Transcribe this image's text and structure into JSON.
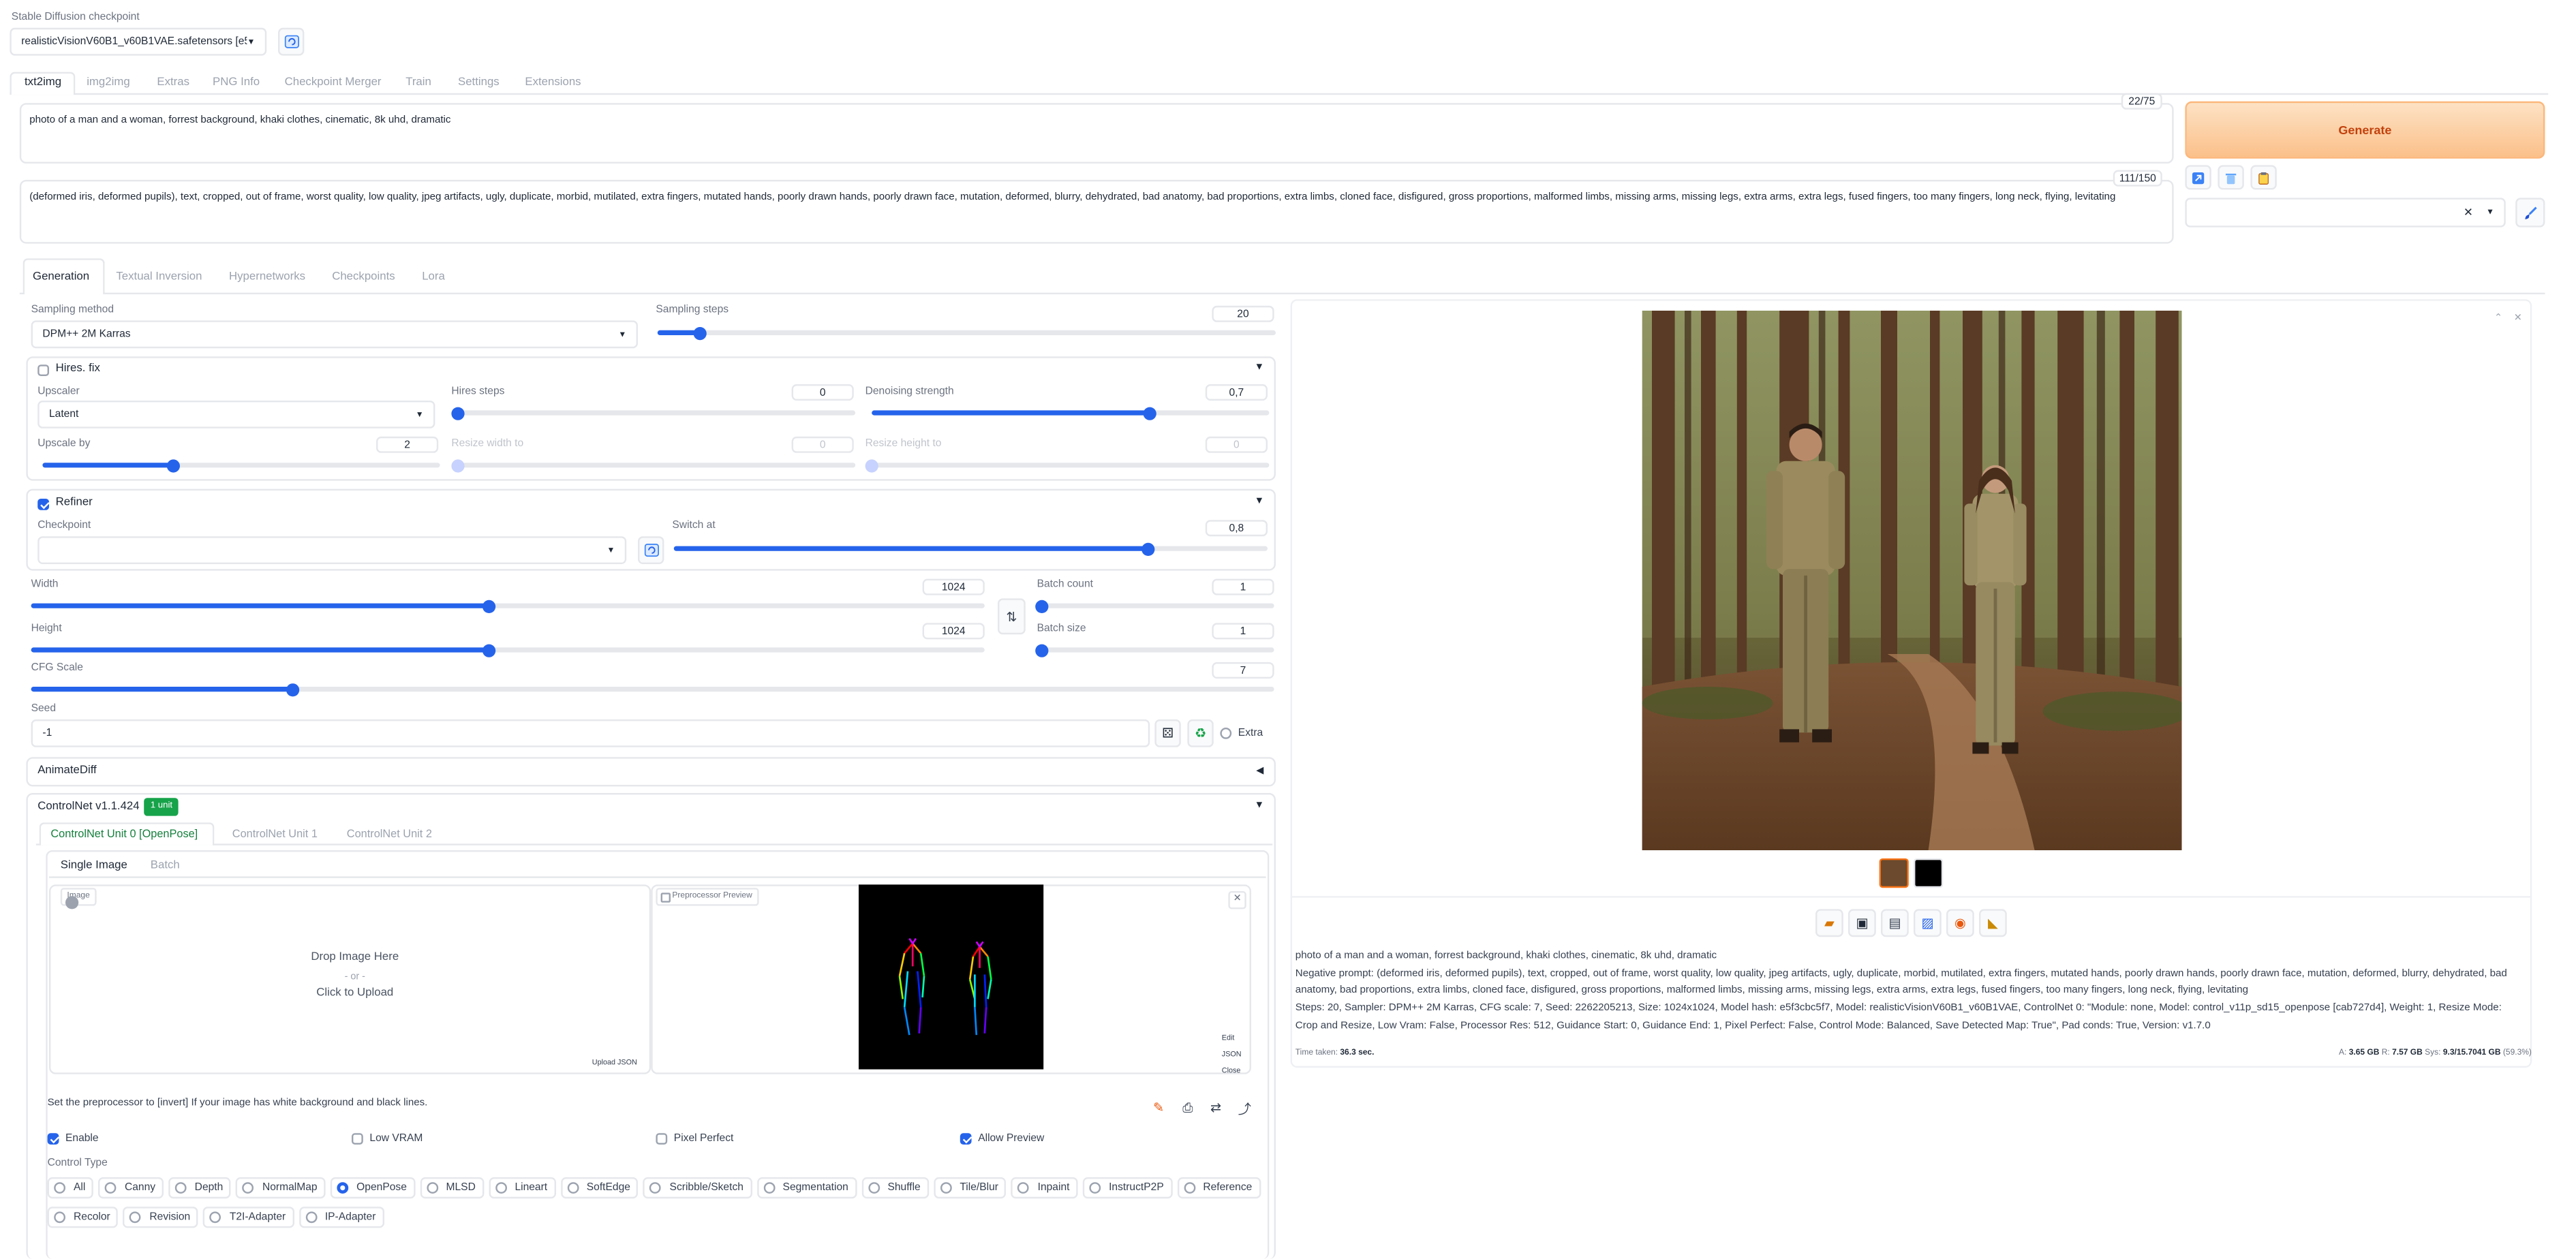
{
  "checkpoint": {
    "label": "Stable Diffusion checkpoint",
    "value": "realisticVisionV60B1_v60B1VAE.safetensors [e5f"
  },
  "main_tabs": [
    "txt2img",
    "img2img",
    "Extras",
    "PNG Info",
    "Checkpoint Merger",
    "Train",
    "Settings",
    "Extensions"
  ],
  "prompt": {
    "text": "photo of a man and a woman, forrest background, khaki clothes, cinematic, 8k uhd, dramatic",
    "counter": "22/75"
  },
  "negative": {
    "text": "(deformed iris, deformed pupils), text, cropped, out of frame, worst quality, low quality, jpeg artifacts, ugly, duplicate, morbid, mutilated, extra fingers, mutated hands, poorly drawn hands, poorly drawn face, mutation, deformed, blurry, dehydrated, bad anatomy, bad proportions, extra limbs, cloned face, disfigured, gross proportions, malformed limbs, missing arms, missing legs, extra arms, extra legs, fused fingers, too many fingers, long neck, flying, levitating",
    "counter": "111/150"
  },
  "generate_label": "Generate",
  "colors": {
    "accent": "#2563eb",
    "generate_start": "#fdd5ad",
    "generate_end": "#fbbf85",
    "generate_text": "#c2410c",
    "badge": "#16a34a",
    "cn_active": "#15803d"
  },
  "sub_tabs": [
    "Generation",
    "Textual Inversion",
    "Hypernetworks",
    "Checkpoints",
    "Lora"
  ],
  "sampling": {
    "method_label": "Sampling method",
    "method": "DPM++ 2M Karras",
    "steps_label": "Sampling steps",
    "steps": "20",
    "steps_frac": 0.07
  },
  "hires": {
    "label": "Hires. fix",
    "checked": false,
    "upscaler_label": "Upscaler",
    "upscaler": "Latent",
    "steps_label": "Hires steps",
    "steps": "0",
    "denoise_label": "Denoising strength",
    "denoise": "0,7",
    "upscale_label": "Upscale by",
    "upscale": "2",
    "rw_label": "Resize width to",
    "rw": "0",
    "rh_label": "Resize height to",
    "rh": "0",
    "denoise_frac": 0.7,
    "upscale_frac": 0.33
  },
  "refiner": {
    "label": "Refiner",
    "checked": true,
    "checkpoint_label": "Checkpoint",
    "switch_label": "Switch at",
    "switch": "0,8",
    "switch_frac": 0.8
  },
  "dims": {
    "width_label": "Width",
    "width": "1024",
    "height_label": "Height",
    "height": "1024",
    "bc_label": "Batch count",
    "bc": "1",
    "bs_label": "Batch size",
    "bs": "1",
    "cfg_label": "CFG Scale",
    "cfg": "7",
    "width_frac": 0.48,
    "height_frac": 0.48,
    "cfg_frac": 0.21
  },
  "seed": {
    "label": "Seed",
    "value": "-1",
    "extra": "Extra"
  },
  "animatediff": {
    "label": "AnimateDiff"
  },
  "controlnet": {
    "label": "ControlNet v1.1.424",
    "badge": "1 unit",
    "units": [
      "ControlNet Unit 0 [OpenPose]",
      "ControlNet Unit 1",
      "ControlNet Unit 2"
    ],
    "modes": [
      "Single Image",
      "Batch"
    ],
    "image_label": "Image",
    "drop": "Drop Image Here",
    "or": "- or -",
    "click": "Click to Upload",
    "preview_label": "Preprocessor Preview",
    "upload_json": "Upload JSON",
    "edit": "Edit",
    "json": "JSON",
    "close": "Close",
    "hint": "Set the preprocessor to [invert] If your image has white background and black lines.",
    "opts": [
      {
        "label": "Enable",
        "checked": true
      },
      {
        "label": "Low VRAM",
        "checked": false
      },
      {
        "label": "Pixel Perfect",
        "checked": false
      },
      {
        "label": "Allow Preview",
        "checked": true
      }
    ],
    "control_type_label": "Control Type",
    "types_row1": [
      "All",
      "Canny",
      "Depth",
      "NormalMap",
      "OpenPose",
      "MLSD",
      "Lineart",
      "SoftEdge",
      "Scribble/Sketch",
      "Segmentation",
      "Shuffle",
      "Tile/Blur",
      "Inpaint",
      "InstructP2P",
      "Reference"
    ],
    "types_row2": [
      "Recolor",
      "Revision",
      "T2I-Adapter",
      "IP-Adapter"
    ],
    "selected_type": "OpenPose"
  },
  "output": {
    "prompt_line": "photo of a man and a woman, forrest background, khaki clothes, cinematic, 8k uhd, dramatic",
    "negative_line": "Negative prompt: (deformed iris, deformed pupils), text, cropped, out of frame, worst quality, low quality, jpeg artifacts, ugly, duplicate, morbid, mutilated, extra fingers, mutated hands, poorly drawn hands, poorly drawn face, mutation, deformed, blurry, dehydrated, bad anatomy, bad proportions, extra limbs, cloned face, disfigured, gross proportions, malformed limbs, missing arms, missing legs, extra arms, extra legs, fused fingers, too many fingers, long neck, flying, levitating",
    "params_line": "Steps: 20, Sampler: DPM++ 2M Karras, CFG scale: 7, Seed: 2262205213, Size: 1024x1024, Model hash: e5f3cbc5f7, Model: realisticVisionV60B1_v60B1VAE, ControlNet 0: \"Module: none, Model: control_v11p_sd15_openpose [cab727d4], Weight: 1, Resize Mode: Crop and Resize, Low Vram: False, Processor Res: 512, Guidance Start: 0, Guidance End: 1, Pixel Perfect: False, Control Mode: Balanced, Save Detected Map: True\", Pad conds: True, Version: v1.7.0",
    "time_label": "Time taken:",
    "time_value": "36.3 sec.",
    "vram": {
      "a_label": "A:",
      "a_value": "3.65 GB",
      "r_label": "R:",
      "r_value": "7.57 GB",
      "sys_label": "Sys:",
      "sys_value": "9.3/15.7041 GB",
      "pct": "(59.3%)"
    }
  }
}
